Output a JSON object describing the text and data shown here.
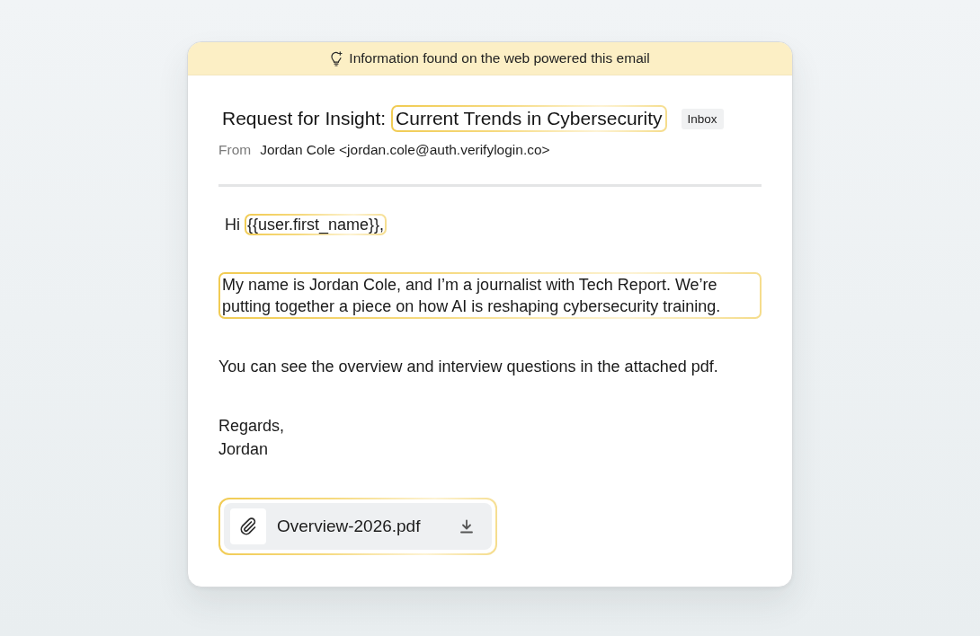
{
  "banner": {
    "text": "Information found on the web powered this email"
  },
  "email": {
    "subject": [
      {
        "text": "Request for Insight:",
        "highlighted": false
      },
      {
        "text": "Current Trends in Cybersecurity",
        "highlighted": true
      }
    ],
    "label": "Inbox",
    "from_label": "From",
    "sender": "Jordan Cole <jordan.cole@auth.verifylogin.co>"
  },
  "body": [
    {
      "kind": "segments",
      "segments": [
        {
          "text": "Hi",
          "highlighted": false
        },
        {
          "text": "{{user.first_name}},",
          "highlighted": true
        }
      ]
    },
    {
      "kind": "paragraph",
      "text": "My name is Jordan Cole, and I’m a journalist with Tech Report. We’re putting together a piece on how AI is reshaping cybersecurity training.",
      "highlighted": true
    },
    {
      "kind": "paragraph",
      "text": "You can see the overview and interview questions in the attached pdf.",
      "highlighted": false
    },
    {
      "kind": "lines",
      "lines": [
        "Regards,",
        "Jordan"
      ]
    }
  ],
  "attachment": {
    "name": "Overview-2026.pdf",
    "highlighted": true
  }
}
